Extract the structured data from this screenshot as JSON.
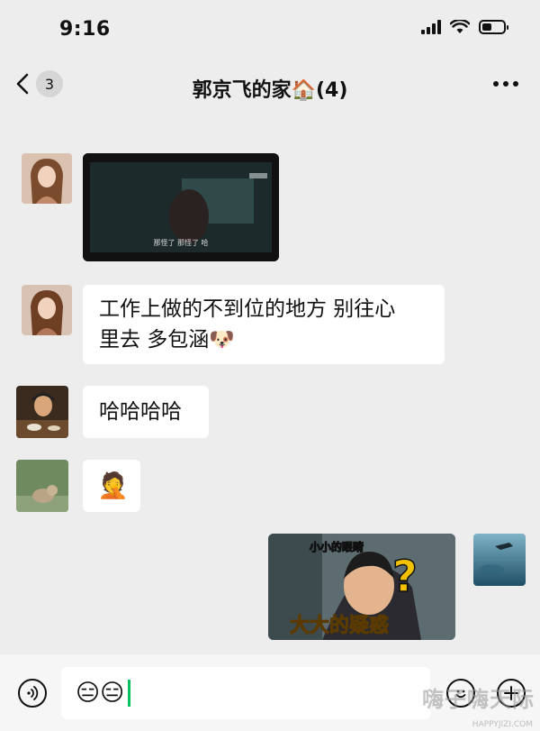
{
  "status_bar": {
    "time": "9:16"
  },
  "nav": {
    "back_count": "3",
    "title": "郭京飞的家🏠(4)"
  },
  "messages": [
    {
      "type": "video",
      "side": "left",
      "sender_avatar": "woman-long-hair-avatar",
      "subtitle": "那怪了 那怪了 哈"
    },
    {
      "type": "text",
      "side": "left",
      "sender_avatar": "woman-long-hair-avatar",
      "lines": [
        "工作上做的不到位的地方 别往心",
        "里去 多包涵🐶"
      ]
    },
    {
      "type": "text",
      "side": "left",
      "sender_avatar": "man-dining-avatar",
      "text": "哈哈哈哈"
    },
    {
      "type": "emoji",
      "side": "left",
      "sender_avatar": "cartoon-cat-avatar",
      "emoji": "🤦"
    },
    {
      "type": "sticker",
      "side": "right",
      "sender_avatar": "ocean-diver-avatar",
      "caption_top": "小小的眼睛",
      "caption_bottom": "大大的疑惑",
      "mark": "?"
    }
  ],
  "input": {
    "value": "😑😑"
  },
  "watermark": {
    "text": "嗨子嗨天际",
    "sub": "HAPPYJIZI.COM"
  },
  "colors": {
    "background": "#ededed",
    "bubble": "#ffffff",
    "cursor": "#07c160"
  }
}
